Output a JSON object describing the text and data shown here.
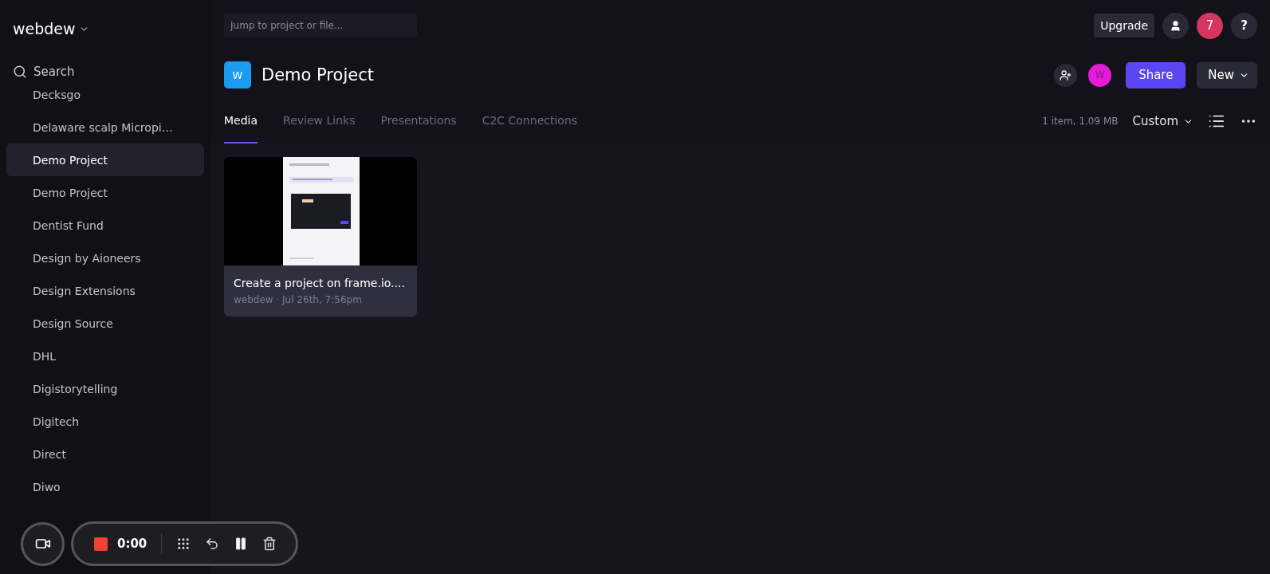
{
  "workspace": {
    "name": "webdew"
  },
  "sidebar": {
    "search_label": "Search",
    "items": [
      {
        "label": "Decksgo",
        "selected": false
      },
      {
        "label": "Delaware scalp Micropi…",
        "selected": false
      },
      {
        "label": "Demo Project",
        "selected": true
      },
      {
        "label": "Demo Project",
        "selected": false
      },
      {
        "label": "Dentist Fund",
        "selected": false
      },
      {
        "label": "Design by Aioneers",
        "selected": false
      },
      {
        "label": "Design Extensions",
        "selected": false
      },
      {
        "label": "Design Source",
        "selected": false
      },
      {
        "label": "DHL",
        "selected": false
      },
      {
        "label": "Digistorytelling",
        "selected": false
      },
      {
        "label": "Digitech",
        "selected": false
      },
      {
        "label": "Direct",
        "selected": false
      },
      {
        "label": "Diwo",
        "selected": false
      }
    ]
  },
  "topbar": {
    "search_placeholder": "Jump to project or file...",
    "upgrade": "Upgrade",
    "notifications": "7",
    "help": "?"
  },
  "project": {
    "initial": "W",
    "title": "Demo Project",
    "member_initial": "W",
    "share": "Share",
    "new": "New"
  },
  "tabs": [
    {
      "label": "Media",
      "selected": true
    },
    {
      "label": "Review Links",
      "selected": false
    },
    {
      "label": "Presentations",
      "selected": false
    },
    {
      "label": "C2C Connections",
      "selected": false
    }
  ],
  "summary": "1 item, 1.09 MB",
  "sort": "Custom",
  "assets": [
    {
      "kind": "picture",
      "title": "Create a project on frame.io....",
      "meta": "webdew · Jul 26th, 7:56pm"
    }
  ],
  "recorder": {
    "time": "0:00"
  }
}
